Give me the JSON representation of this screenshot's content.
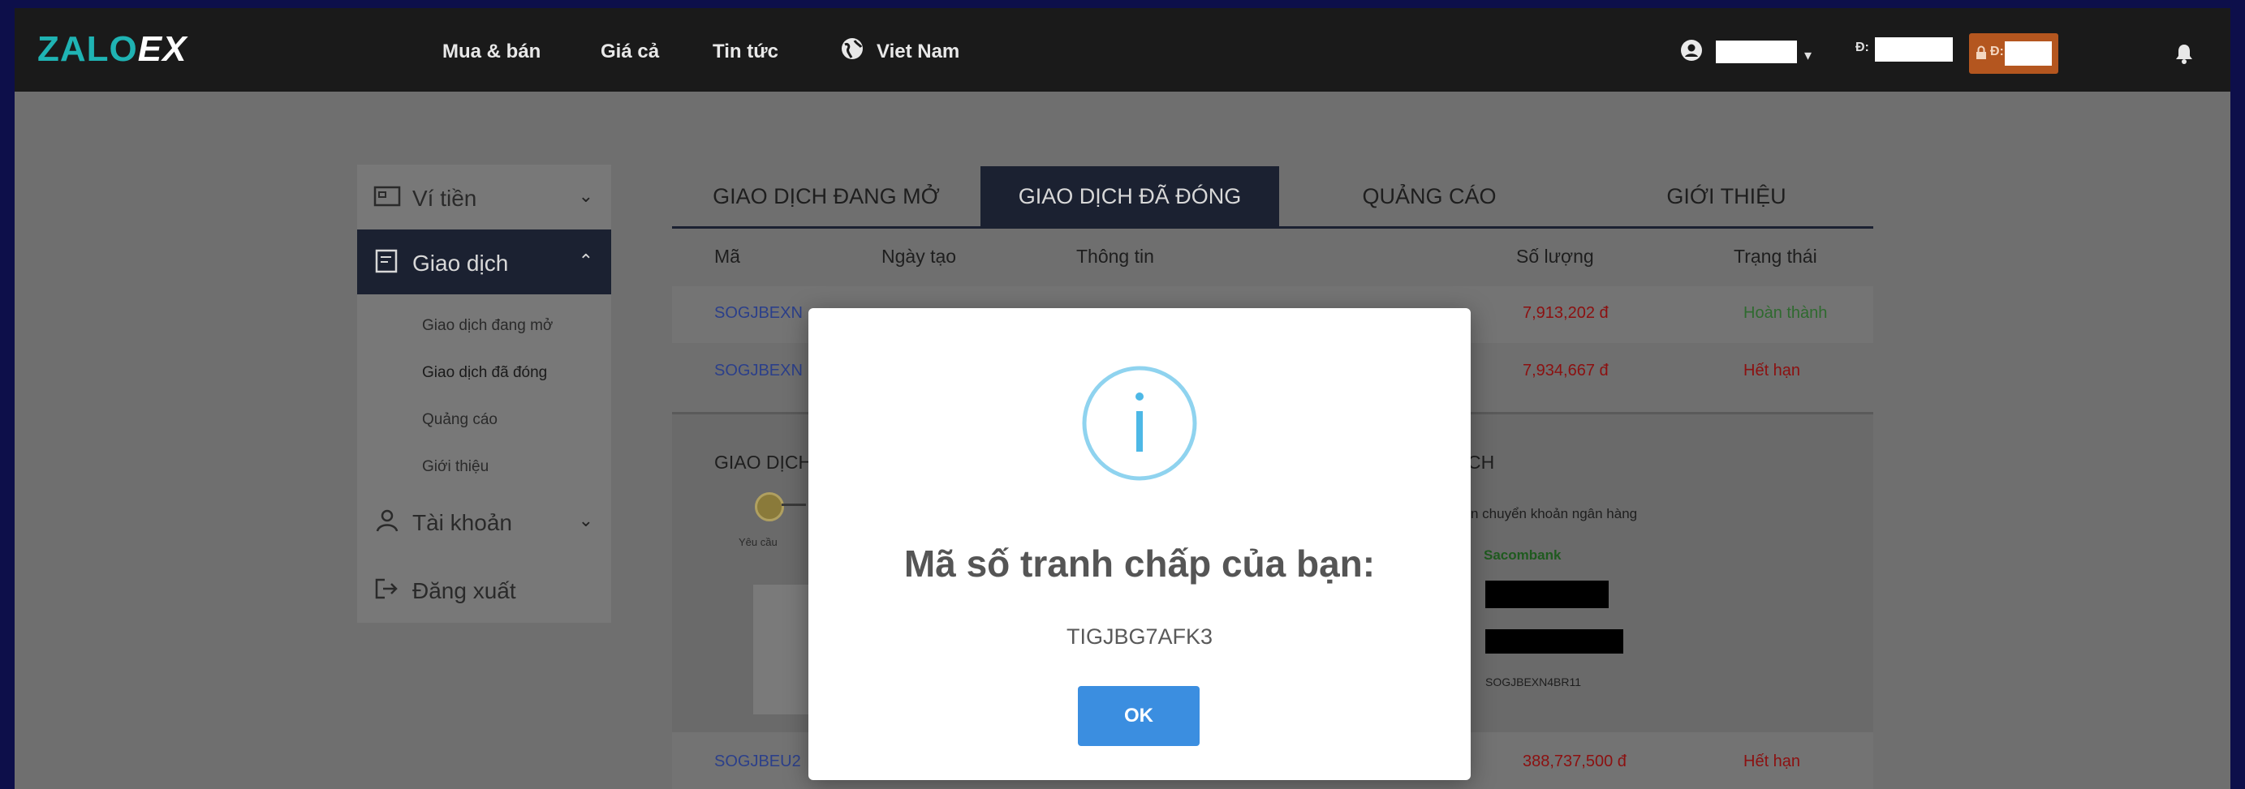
{
  "header": {
    "logo_part1": "ZALO",
    "logo_part2": "EX",
    "nav": [
      "Mua & bán",
      "Giá cả",
      "Tin tức",
      "Viet Nam"
    ],
    "balance_prefix": "Đ:",
    "wallet_prefix": "Đ:"
  },
  "sidebar": {
    "items": [
      {
        "label": "Ví tiền"
      },
      {
        "label": "Giao dịch"
      },
      {
        "label": "Tài khoản"
      },
      {
        "label": "Đăng xuất"
      }
    ],
    "sub_items": [
      "Giao dịch đang mở",
      "Giao dịch đã đóng",
      "Quảng cáo",
      "Giới thiệu"
    ]
  },
  "tabs": [
    "GIAO DỊCH ĐANG MỞ",
    "GIAO DỊCH ĐÃ ĐÓNG",
    "QUẢNG CÁO",
    "GIỚI THIỆU"
  ],
  "table": {
    "headers": [
      "Mã",
      "Ngày tạo",
      "Thông tin",
      "Số lượng",
      "Trạng thái"
    ],
    "rows": [
      {
        "code": "SOGJBEXN",
        "amount": "7,913,202 đ",
        "status": "Hoàn thành"
      },
      {
        "code": "SOGJBEXN",
        "amount": "7,934,667 đ",
        "status": "Hết hạn"
      },
      {
        "code": "SOGJBEU2",
        "amount": "388,737,500 đ",
        "status": "Hết hạn"
      }
    ]
  },
  "panel": {
    "left_title": "GIAO DỊCH",
    "right_title": "CH",
    "step_label": "Yêu cầu",
    "bank_hint": "n chuyển khoản ngân hàng",
    "bank_name": "Sacombank",
    "ref_code": "SOGJBEXN4BR11"
  },
  "modal": {
    "title": "Mã số tranh chấp của bạn:",
    "code": "TIGJBG7AFK3",
    "ok_label": "OK"
  },
  "colors": {
    "accent": "#3b8ee0",
    "brand_teal": "#1fb3b3",
    "dark_navy": "#1b2131",
    "wallet_orange": "#b4561f"
  }
}
